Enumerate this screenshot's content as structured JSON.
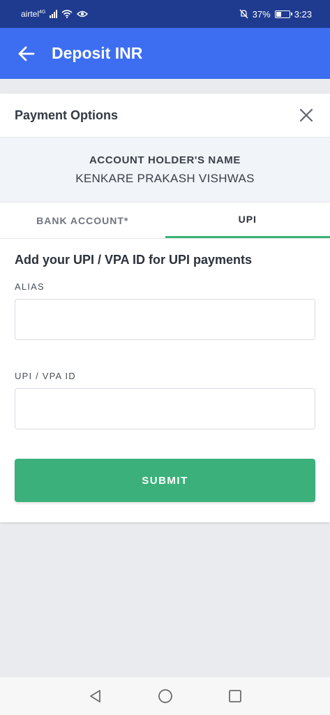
{
  "status_bar": {
    "carrier": "airtel",
    "network": "4G",
    "battery": "37%",
    "battery_level": 0.37,
    "time": "3:23",
    "icons": [
      "signal-icon",
      "wifi-icon",
      "eye-icon",
      "mute-bell-icon",
      "battery-icon"
    ]
  },
  "app_bar": {
    "title": "Deposit INR",
    "back_icon": "arrow-left-icon",
    "background": "#3d6ef2"
  },
  "card": {
    "title": "Payment Options",
    "close_icon": "close-icon",
    "holder_label": "ACCOUNT HOLDER'S NAME",
    "holder_name": "KENKARE PRAKASH VISHWAS"
  },
  "tabs": [
    {
      "label": "BANK ACCOUNT*",
      "active": false
    },
    {
      "label": "UPI",
      "active": true
    }
  ],
  "form": {
    "heading": "Add your UPI / VPA ID for UPI payments",
    "alias_label": "ALIAS",
    "alias_value": "",
    "upi_label": "UPI / VPA ID",
    "upi_value": "",
    "submit_label": "SUBMIT"
  },
  "colors": {
    "accent_green": "#3bb07a",
    "tab_indicator": "#3bb573",
    "status_bar": "#1f3b8f"
  },
  "nav_bar": {
    "icons": [
      "back-triangle-icon",
      "home-circle-icon",
      "recents-square-icon"
    ]
  }
}
